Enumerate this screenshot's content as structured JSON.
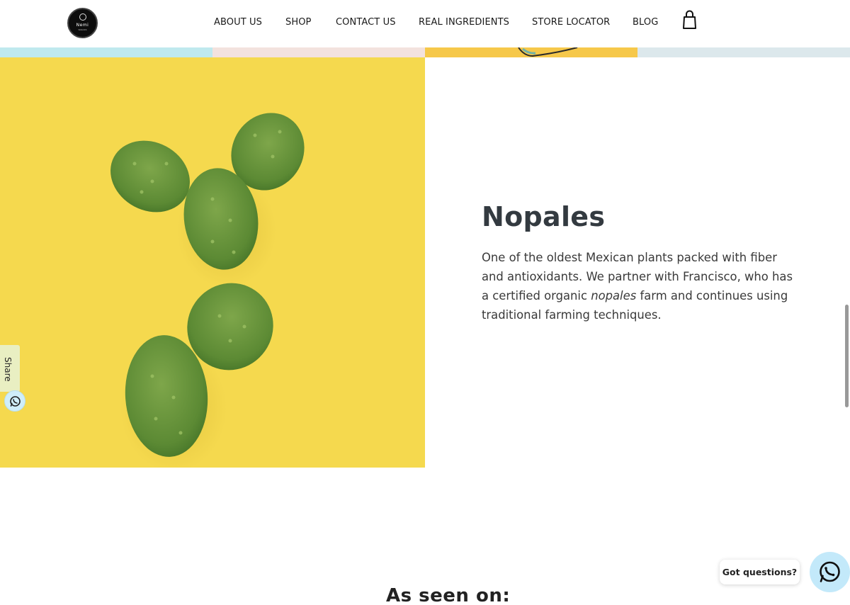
{
  "brand": {
    "logo_text": "Nemi",
    "logo_subtext": "SNACKS"
  },
  "nav": {
    "items": [
      {
        "label": "ABOUT US"
      },
      {
        "label": "SHOP"
      },
      {
        "label": "CONTACT US"
      },
      {
        "label": "REAL INGREDIENTS"
      },
      {
        "label": "STORE LOCATOR"
      },
      {
        "label": "BLOG"
      }
    ],
    "cart_icon": "shopping-bag-icon"
  },
  "ingredient": {
    "title": "Nopales",
    "desc_part1": "One of the oldest Mexican plants packed with fiber and antioxidants. We partner with Francisco,  who has a certified organic ",
    "desc_emphasis": "nopales",
    "desc_part2": " farm and continues using traditional farming techniques."
  },
  "share": {
    "label": "Share",
    "icon": "whatsapp-icon"
  },
  "press": {
    "heading": "As seen on:"
  },
  "chat": {
    "bubble_text": "Got questions?",
    "icon": "whatsapp-icon"
  },
  "colors": {
    "photo_bg": "#f5d94e",
    "strip_cyan": "#bfe9ee",
    "strip_pink": "#f3e2de",
    "strip_yellow": "#f6c84a",
    "strip_grey": "#dce8ec",
    "chat_button": "#c3e9fa",
    "title": "#333a40"
  }
}
